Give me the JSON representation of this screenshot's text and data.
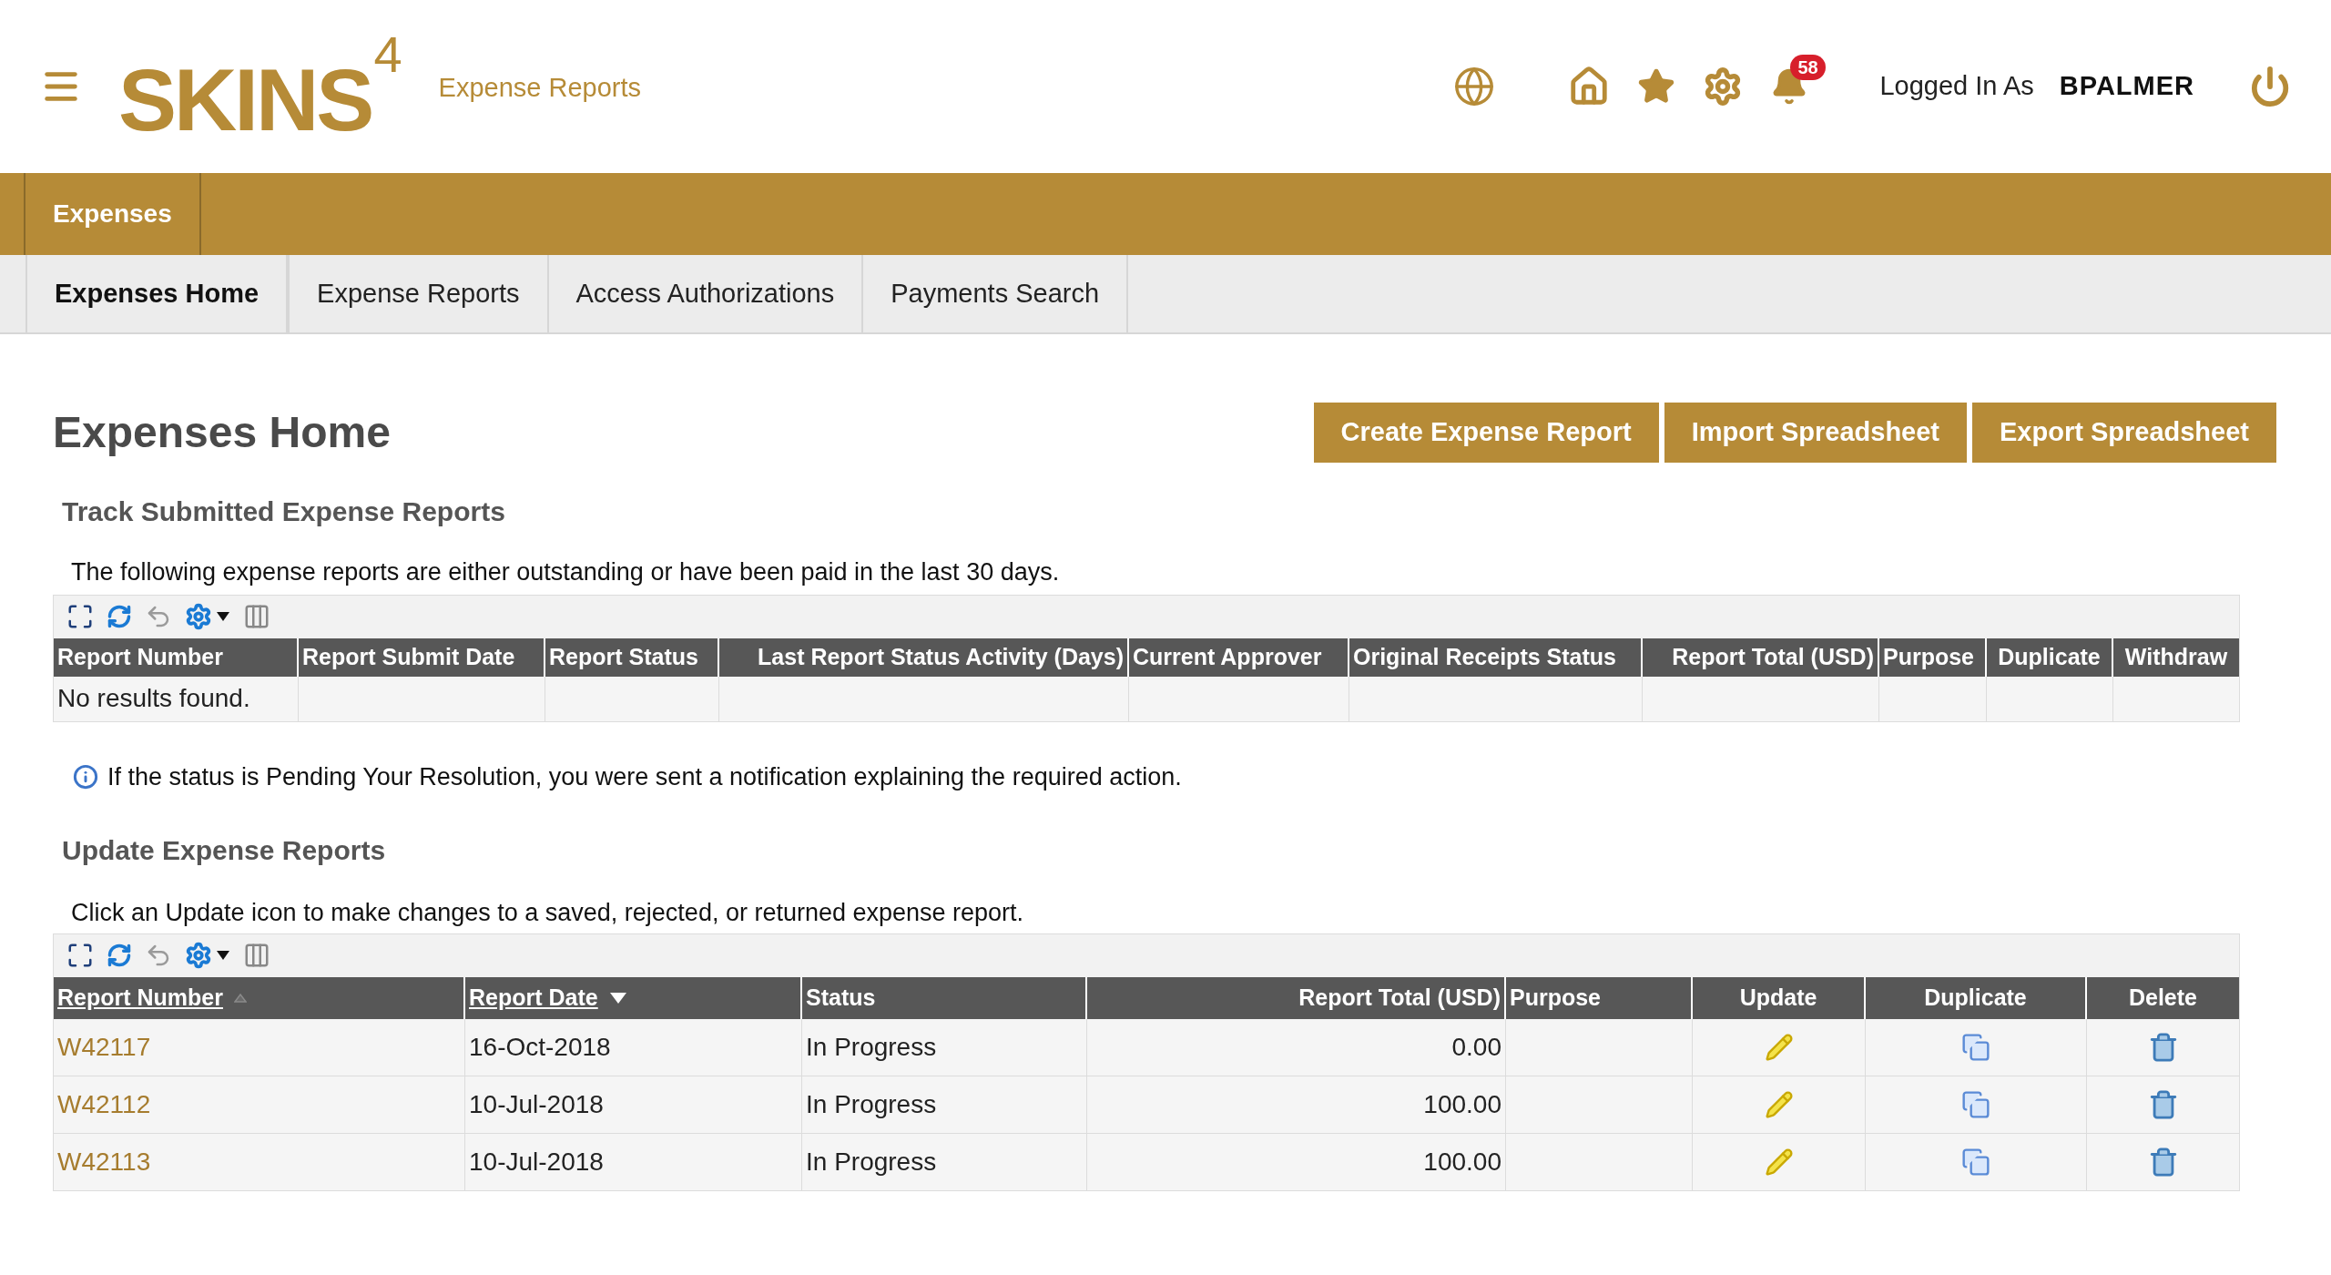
{
  "header": {
    "logo": {
      "text": "SKINS",
      "superscript": "4"
    },
    "module_title": "Expense Reports",
    "notification_count": "58",
    "logged_in_label": "Logged In As",
    "username": "BPALMER"
  },
  "nav": {
    "section": "Expenses"
  },
  "tabs": [
    {
      "label": "Expenses Home",
      "selected": true
    },
    {
      "label": "Expense Reports",
      "selected": false
    },
    {
      "label": "Access Authorizations",
      "selected": false
    },
    {
      "label": "Payments Search",
      "selected": false
    }
  ],
  "page": {
    "title": "Expenses Home",
    "buttons": [
      "Create Expense Report",
      "Import Spreadsheet",
      "Export Spreadsheet"
    ]
  },
  "track": {
    "heading": "Track Submitted Expense Reports",
    "description": "The following expense reports are either outstanding or have been paid in the last 30 days.",
    "columns": [
      "Report Number",
      "Report Submit Date",
      "Report Status",
      "Last Report Status Activity (Days)",
      "Current Approver",
      "Original Receipts Status",
      "Report Total (USD)",
      "Purpose",
      "Duplicate",
      "Withdraw"
    ],
    "empty_message": "No results found."
  },
  "info": "If the status is Pending Your Resolution, you were sent a notification explaining the required action.",
  "update": {
    "heading": "Update Expense Reports",
    "description": "Click an Update icon to make changes to a saved, rejected, or returned expense report.",
    "columns": [
      {
        "label": "Report Number",
        "sortable": true,
        "sorted": false
      },
      {
        "label": "Report Date",
        "sortable": true,
        "sorted": true
      },
      {
        "label": "Status",
        "sortable": false
      },
      {
        "label": "Report Total (USD)",
        "sortable": false
      },
      {
        "label": "Purpose",
        "sortable": false
      },
      {
        "label": "Update",
        "sortable": false
      },
      {
        "label": "Duplicate",
        "sortable": false
      },
      {
        "label": "Delete",
        "sortable": false
      }
    ],
    "rows": [
      {
        "report_number": "W42117",
        "report_date": "16-Oct-2018",
        "status": "In Progress",
        "total": "0.00"
      },
      {
        "report_number": "W42112",
        "report_date": "10-Jul-2018",
        "status": "In Progress",
        "total": "100.00"
      },
      {
        "report_number": "W42113",
        "report_date": "10-Jul-2018",
        "status": "In Progress",
        "total": "100.00"
      }
    ]
  }
}
